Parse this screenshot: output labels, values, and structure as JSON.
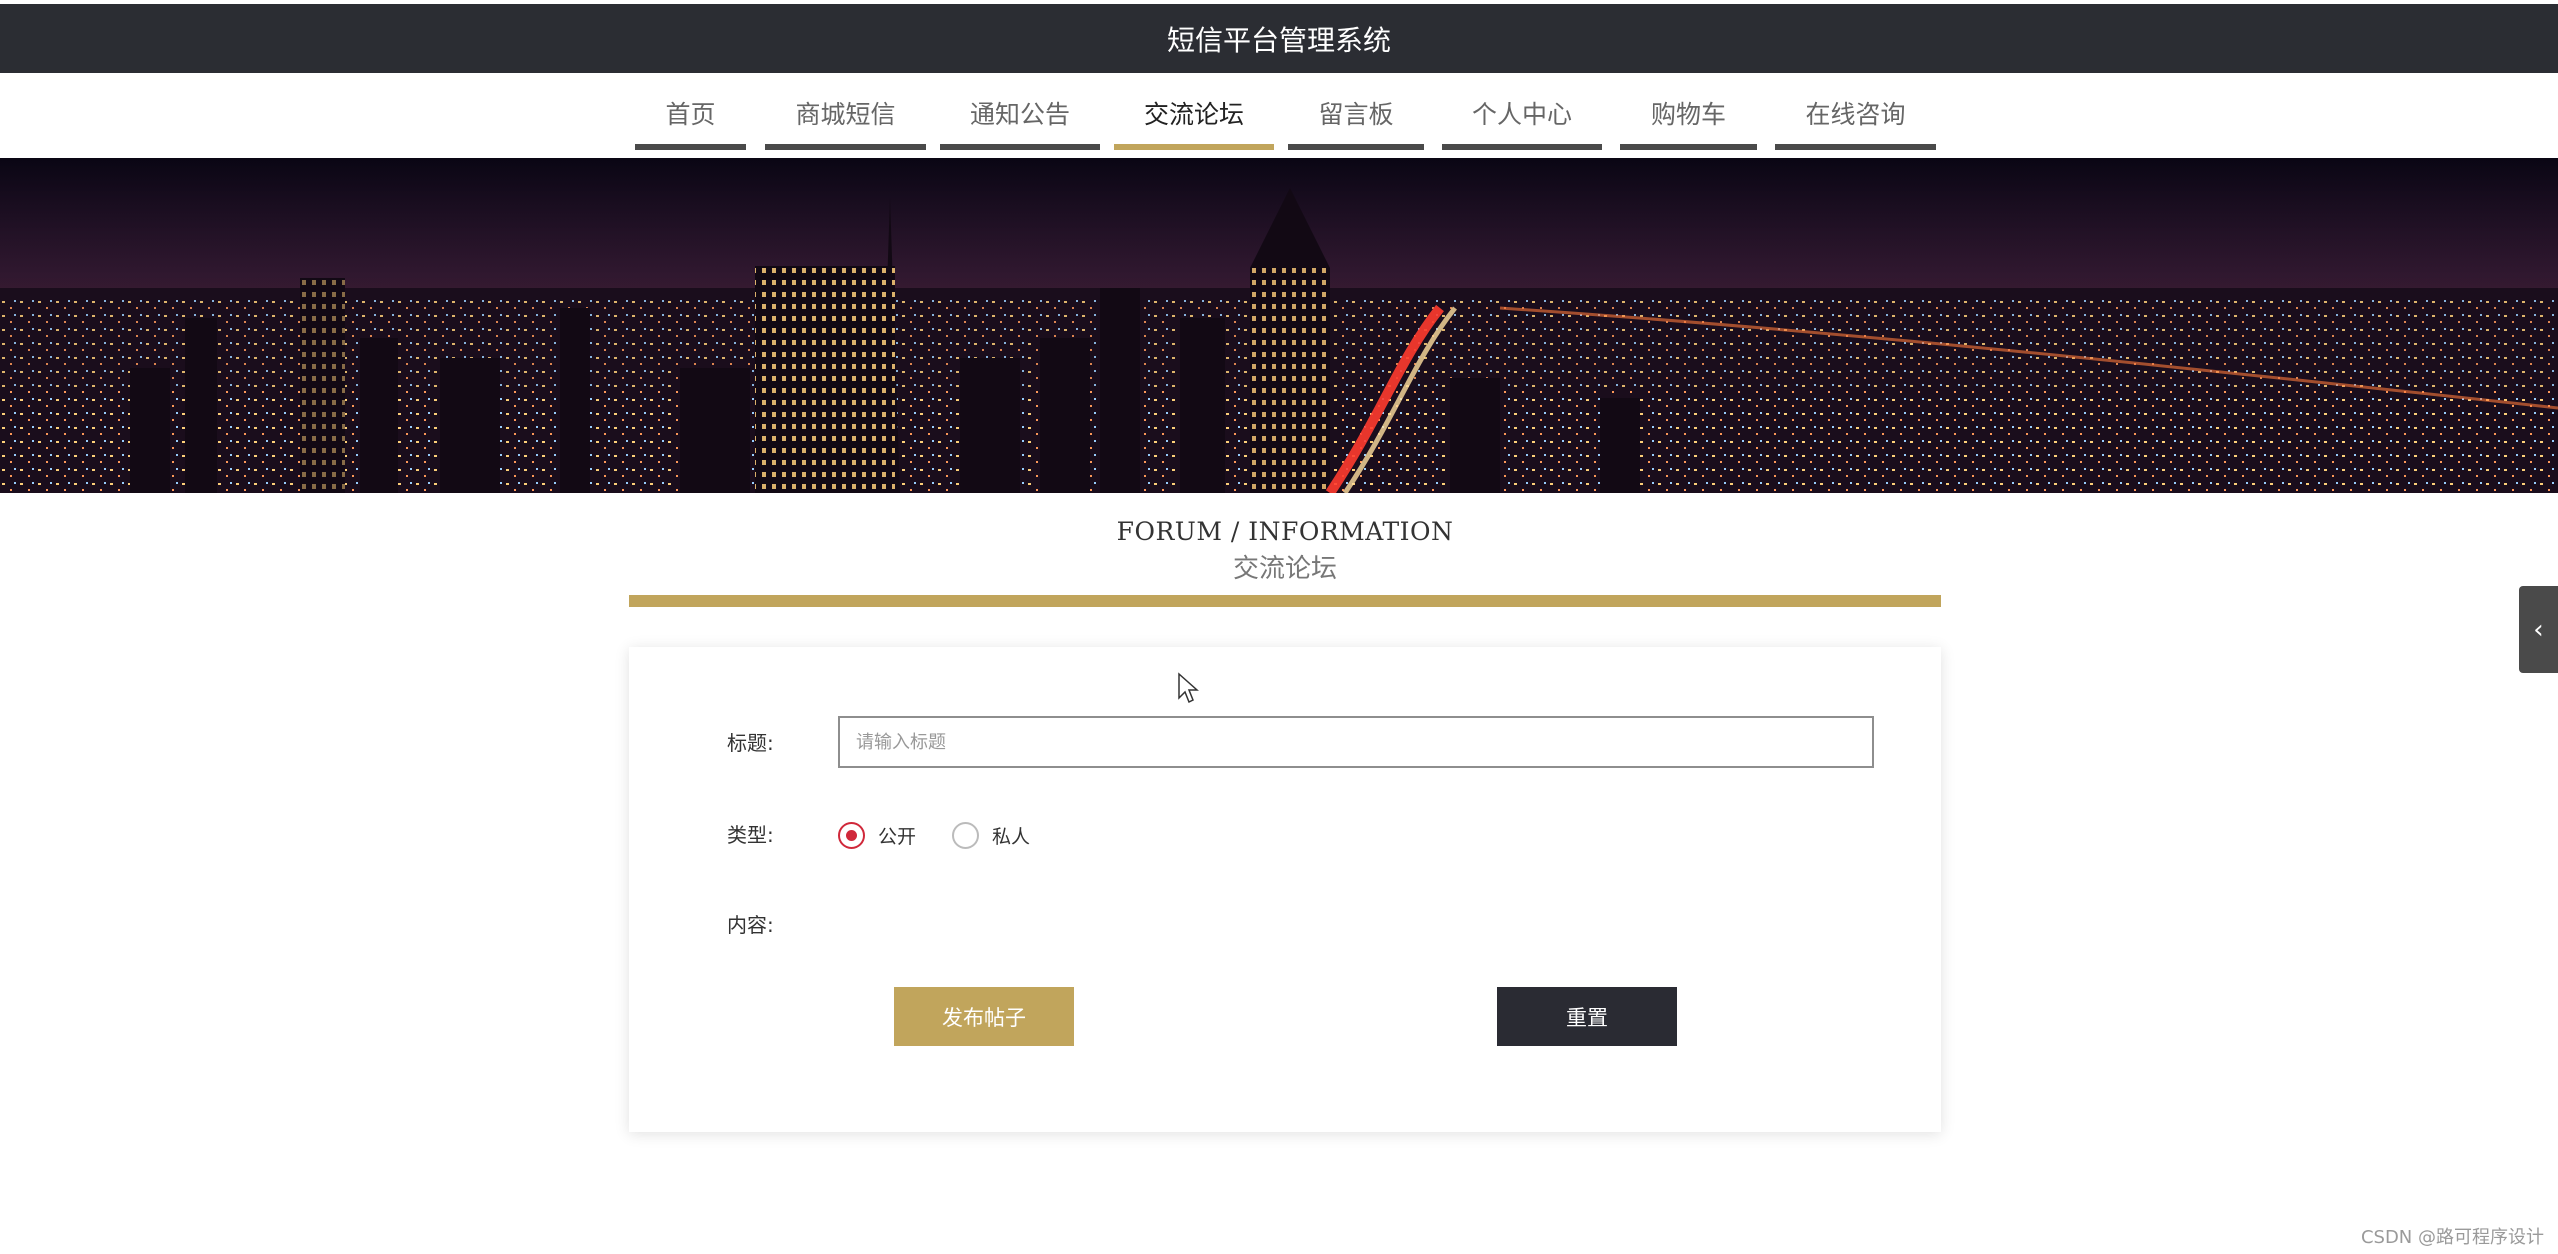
{
  "header": {
    "title": "短信平台管理系统"
  },
  "nav": {
    "items": [
      {
        "label": "首页",
        "active": false
      },
      {
        "label": "商城短信",
        "active": false
      },
      {
        "label": "通知公告",
        "active": false
      },
      {
        "label": "交流论坛",
        "active": true
      },
      {
        "label": "留言板",
        "active": false
      },
      {
        "label": "个人中心",
        "active": false
      },
      {
        "label": "购物车",
        "active": false
      },
      {
        "label": "在线咨询",
        "active": false
      }
    ]
  },
  "section": {
    "title_en": "FORUM / INFORMATION",
    "title_zh": "交流论坛"
  },
  "form": {
    "title_label": "标题:",
    "title_placeholder": "请输入标题",
    "title_value": "",
    "type_label": "类型:",
    "type_options": [
      {
        "label": "公开",
        "checked": true
      },
      {
        "label": "私人",
        "checked": false
      }
    ],
    "content_label": "内容:",
    "publish_label": "发布帖子",
    "reset_label": "重置"
  },
  "side_tab": {
    "icon": "chevron-left-icon",
    "glyph": "‹"
  },
  "watermark": "CSDN @路可程序设计",
  "colors": {
    "header_bg": "#2b2d33",
    "accent_gold": "#c1a55c",
    "nav_underline": "#4a4a4a",
    "radio_checked": "#d0283a",
    "reset_bg": "#2a2b33"
  }
}
